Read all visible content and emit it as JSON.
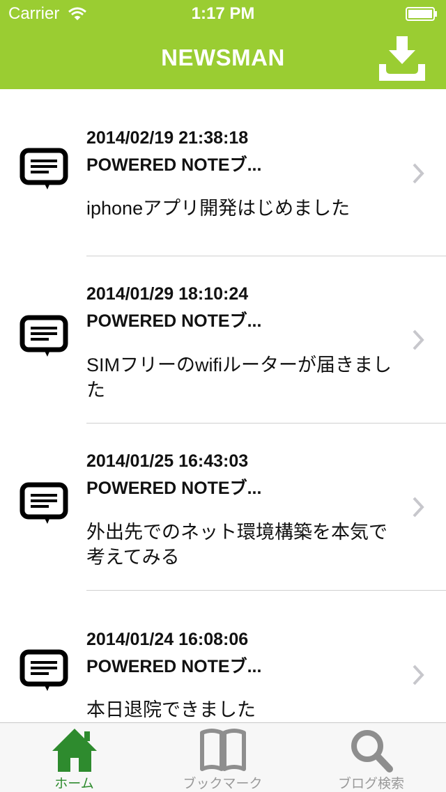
{
  "status": {
    "carrier": "Carrier",
    "time": "1:17 PM"
  },
  "nav": {
    "title": "NEWSMAN",
    "download_icon": "download-tray-icon"
  },
  "articles": [
    {
      "date": "2014/02/19 21:38:18",
      "source": "POWERED NOTEブ...",
      "title": "iphoneアプリ開発はじめました"
    },
    {
      "date": "2014/01/29 18:10:24",
      "source": "POWERED NOTEブ...",
      "title": "SIMフリーのwifiルーターが届きました"
    },
    {
      "date": "2014/01/25 16:43:03",
      "source": "POWERED NOTEブ...",
      "title": "外出先でのネット環境構築を本気で考えてみる"
    },
    {
      "date": "2014/01/24 16:08:06",
      "source": "POWERED NOTEブ...",
      "title": "本日退院できました"
    }
  ],
  "tabs": [
    {
      "label": "ホーム",
      "icon": "home-icon",
      "active": true
    },
    {
      "label": "ブックマーク",
      "icon": "book-icon",
      "active": false
    },
    {
      "label": "ブログ検索",
      "icon": "search-icon",
      "active": false
    }
  ],
  "colors": {
    "accent": "#9acd32",
    "active_tab": "#2e8b2e",
    "inactive_tab": "#999999"
  }
}
